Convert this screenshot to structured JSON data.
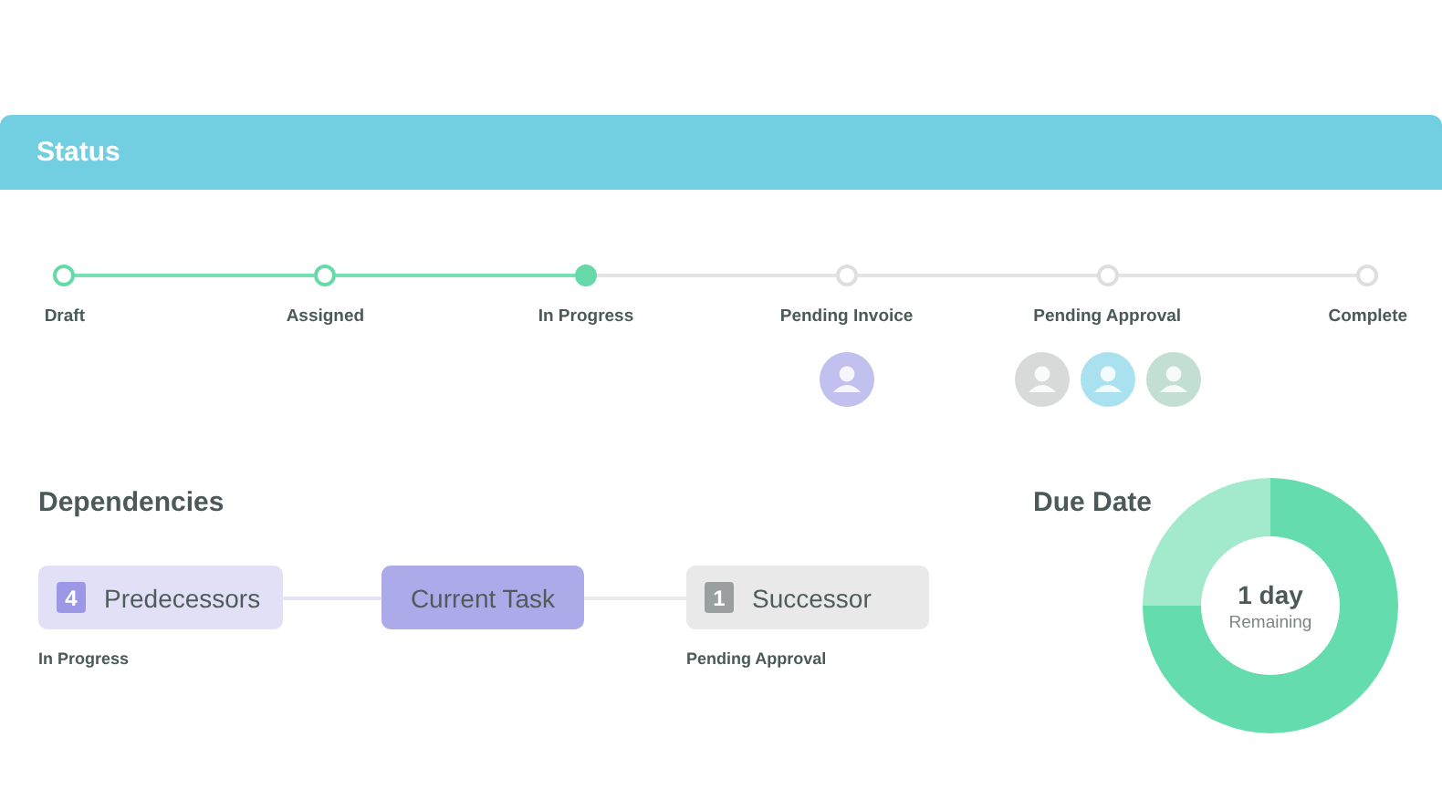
{
  "header": {
    "title": "Status"
  },
  "steps": [
    {
      "label": "Draft",
      "completed": true,
      "selected": false
    },
    {
      "label": "Assigned",
      "completed": true,
      "selected": false
    },
    {
      "label": "In Progress",
      "completed": false,
      "selected": true
    },
    {
      "label": "Pending Invoice",
      "completed": false,
      "selected": false,
      "avatars": [
        {
          "color": "#c2c0ef"
        }
      ]
    },
    {
      "label": "Pending Approval",
      "completed": false,
      "selected": false,
      "avatars": [
        {
          "color": "#d8dad9"
        },
        {
          "color": "#a9e2ee"
        },
        {
          "color": "#c3dfd3"
        }
      ]
    },
    {
      "label": "Complete",
      "completed": false,
      "selected": false
    }
  ],
  "dependencies": {
    "title": "Dependencies",
    "items": [
      {
        "kind": "predecessor",
        "count": "4",
        "label": "Predecessors",
        "status": "In Progress"
      },
      {
        "kind": "current",
        "label": "Current Task"
      },
      {
        "kind": "successor",
        "count": "1",
        "label": "Successor",
        "status": "Pending Approval"
      }
    ]
  },
  "due_date": {
    "title": "Due Date",
    "value": "1 day",
    "caption": "Remaining"
  }
}
